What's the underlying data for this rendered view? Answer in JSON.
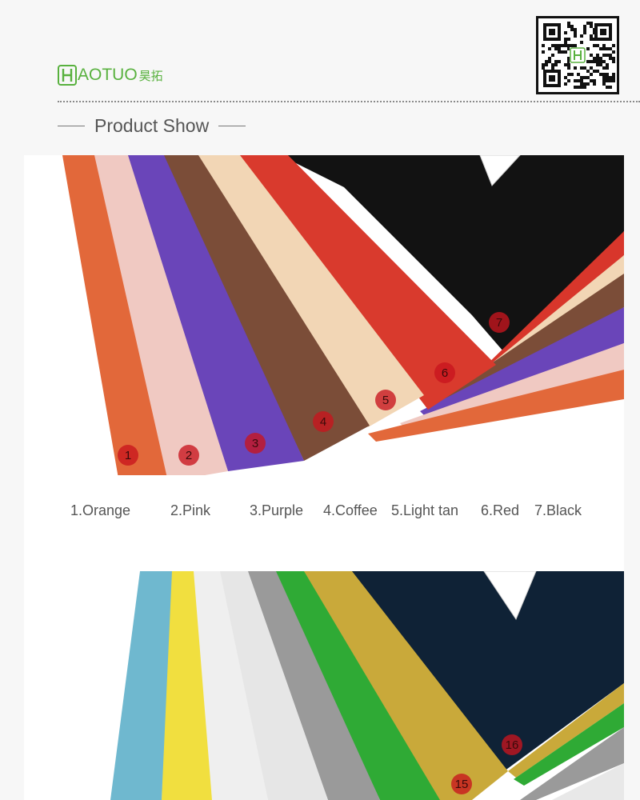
{
  "brand": {
    "name": "AOTUO",
    "name_cn": "昊拓",
    "color": "#58b13e"
  },
  "qr_code": {
    "icon": "qr-code-icon"
  },
  "section": {
    "title": "Product Show"
  },
  "product_photo_1": {
    "markers": [
      "1",
      "2",
      "3",
      "4",
      "5",
      "6",
      "7"
    ],
    "legend": [
      "1.Orange",
      "2.Pink",
      "3.Purple",
      "4.Coffee",
      "5.Light tan",
      "6.Red",
      "7.Black"
    ],
    "colors": [
      "#e2683a",
      "#f0c9c2",
      "#6a45b9",
      "#7b4d38",
      "#f2d6b5",
      "#d93a2d",
      "#121212"
    ]
  },
  "product_photo_2": {
    "markers": [
      "15",
      "16"
    ],
    "colors": [
      "#6fb8cf",
      "#f1df3f",
      "#efefef",
      "#e6e6e6",
      "#9a9a9a",
      "#2faa35",
      "#c9a93a",
      "#0f2236"
    ]
  }
}
